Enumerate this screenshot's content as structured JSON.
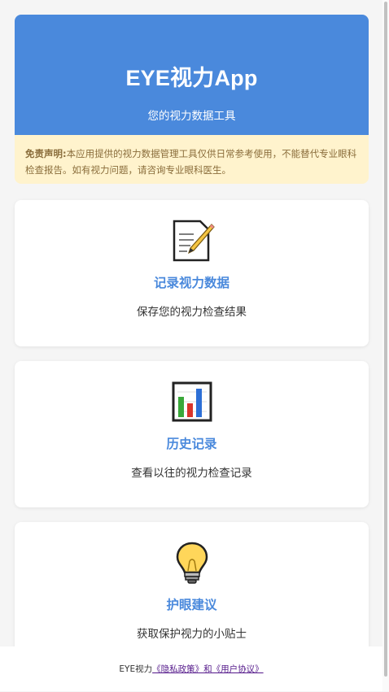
{
  "header": {
    "title": "EYE视力App",
    "subtitle": "您的视力数据工具"
  },
  "disclaimer": {
    "label": "免责声明:",
    "text": "本应用提供的视力数据管理工具仅供日常参考使用，不能替代专业眼科检查报告。如有视力问题，请咨询专业眼科医生。"
  },
  "cards": [
    {
      "icon": "memo-icon",
      "title": "记录视力数据",
      "desc": "保存您的视力检查结果"
    },
    {
      "icon": "bar-chart-icon",
      "title": "历史记录",
      "desc": "查看以往的视力检查记录"
    },
    {
      "icon": "light-bulb-icon",
      "title": "护眼建议",
      "desc": "获取保护视力的小贴士"
    }
  ],
  "footer": {
    "brand": "EYE视力",
    "link_text": "《隐私政策》和《用户协议》"
  },
  "colors": {
    "primary": "#4a89dc",
    "disclaimer_bg": "#fff3cd",
    "disclaimer_text": "#8a6d3b",
    "link": "#551a8b"
  }
}
